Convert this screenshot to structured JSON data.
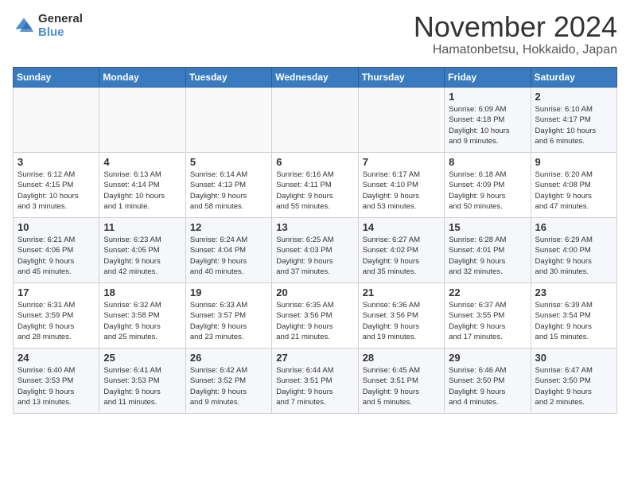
{
  "logo": {
    "general": "General",
    "blue": "Blue"
  },
  "title": "November 2024",
  "location": "Hamatonbetsu, Hokkaido, Japan",
  "days_of_week": [
    "Sunday",
    "Monday",
    "Tuesday",
    "Wednesday",
    "Thursday",
    "Friday",
    "Saturday"
  ],
  "weeks": [
    [
      {
        "day": "",
        "info": ""
      },
      {
        "day": "",
        "info": ""
      },
      {
        "day": "",
        "info": ""
      },
      {
        "day": "",
        "info": ""
      },
      {
        "day": "",
        "info": ""
      },
      {
        "day": "1",
        "info": "Sunrise: 6:09 AM\nSunset: 4:18 PM\nDaylight: 10 hours\nand 9 minutes."
      },
      {
        "day": "2",
        "info": "Sunrise: 6:10 AM\nSunset: 4:17 PM\nDaylight: 10 hours\nand 6 minutes."
      }
    ],
    [
      {
        "day": "3",
        "info": "Sunrise: 6:12 AM\nSunset: 4:15 PM\nDaylight: 10 hours\nand 3 minutes."
      },
      {
        "day": "4",
        "info": "Sunrise: 6:13 AM\nSunset: 4:14 PM\nDaylight: 10 hours\nand 1 minute."
      },
      {
        "day": "5",
        "info": "Sunrise: 6:14 AM\nSunset: 4:13 PM\nDaylight: 9 hours\nand 58 minutes."
      },
      {
        "day": "6",
        "info": "Sunrise: 6:16 AM\nSunset: 4:11 PM\nDaylight: 9 hours\nand 55 minutes."
      },
      {
        "day": "7",
        "info": "Sunrise: 6:17 AM\nSunset: 4:10 PM\nDaylight: 9 hours\nand 53 minutes."
      },
      {
        "day": "8",
        "info": "Sunrise: 6:18 AM\nSunset: 4:09 PM\nDaylight: 9 hours\nand 50 minutes."
      },
      {
        "day": "9",
        "info": "Sunrise: 6:20 AM\nSunset: 4:08 PM\nDaylight: 9 hours\nand 47 minutes."
      }
    ],
    [
      {
        "day": "10",
        "info": "Sunrise: 6:21 AM\nSunset: 4:06 PM\nDaylight: 9 hours\nand 45 minutes."
      },
      {
        "day": "11",
        "info": "Sunrise: 6:23 AM\nSunset: 4:05 PM\nDaylight: 9 hours\nand 42 minutes."
      },
      {
        "day": "12",
        "info": "Sunrise: 6:24 AM\nSunset: 4:04 PM\nDaylight: 9 hours\nand 40 minutes."
      },
      {
        "day": "13",
        "info": "Sunrise: 6:25 AM\nSunset: 4:03 PM\nDaylight: 9 hours\nand 37 minutes."
      },
      {
        "day": "14",
        "info": "Sunrise: 6:27 AM\nSunset: 4:02 PM\nDaylight: 9 hours\nand 35 minutes."
      },
      {
        "day": "15",
        "info": "Sunrise: 6:28 AM\nSunset: 4:01 PM\nDaylight: 9 hours\nand 32 minutes."
      },
      {
        "day": "16",
        "info": "Sunrise: 6:29 AM\nSunset: 4:00 PM\nDaylight: 9 hours\nand 30 minutes."
      }
    ],
    [
      {
        "day": "17",
        "info": "Sunrise: 6:31 AM\nSunset: 3:59 PM\nDaylight: 9 hours\nand 28 minutes."
      },
      {
        "day": "18",
        "info": "Sunrise: 6:32 AM\nSunset: 3:58 PM\nDaylight: 9 hours\nand 25 minutes."
      },
      {
        "day": "19",
        "info": "Sunrise: 6:33 AM\nSunset: 3:57 PM\nDaylight: 9 hours\nand 23 minutes."
      },
      {
        "day": "20",
        "info": "Sunrise: 6:35 AM\nSunset: 3:56 PM\nDaylight: 9 hours\nand 21 minutes."
      },
      {
        "day": "21",
        "info": "Sunrise: 6:36 AM\nSunset: 3:56 PM\nDaylight: 9 hours\nand 19 minutes."
      },
      {
        "day": "22",
        "info": "Sunrise: 6:37 AM\nSunset: 3:55 PM\nDaylight: 9 hours\nand 17 minutes."
      },
      {
        "day": "23",
        "info": "Sunrise: 6:39 AM\nSunset: 3:54 PM\nDaylight: 9 hours\nand 15 minutes."
      }
    ],
    [
      {
        "day": "24",
        "info": "Sunrise: 6:40 AM\nSunset: 3:53 PM\nDaylight: 9 hours\nand 13 minutes."
      },
      {
        "day": "25",
        "info": "Sunrise: 6:41 AM\nSunset: 3:53 PM\nDaylight: 9 hours\nand 11 minutes."
      },
      {
        "day": "26",
        "info": "Sunrise: 6:42 AM\nSunset: 3:52 PM\nDaylight: 9 hours\nand 9 minutes."
      },
      {
        "day": "27",
        "info": "Sunrise: 6:44 AM\nSunset: 3:51 PM\nDaylight: 9 hours\nand 7 minutes."
      },
      {
        "day": "28",
        "info": "Sunrise: 6:45 AM\nSunset: 3:51 PM\nDaylight: 9 hours\nand 5 minutes."
      },
      {
        "day": "29",
        "info": "Sunrise: 6:46 AM\nSunset: 3:50 PM\nDaylight: 9 hours\nand 4 minutes."
      },
      {
        "day": "30",
        "info": "Sunrise: 6:47 AM\nSunset: 3:50 PM\nDaylight: 9 hours\nand 2 minutes."
      }
    ]
  ]
}
